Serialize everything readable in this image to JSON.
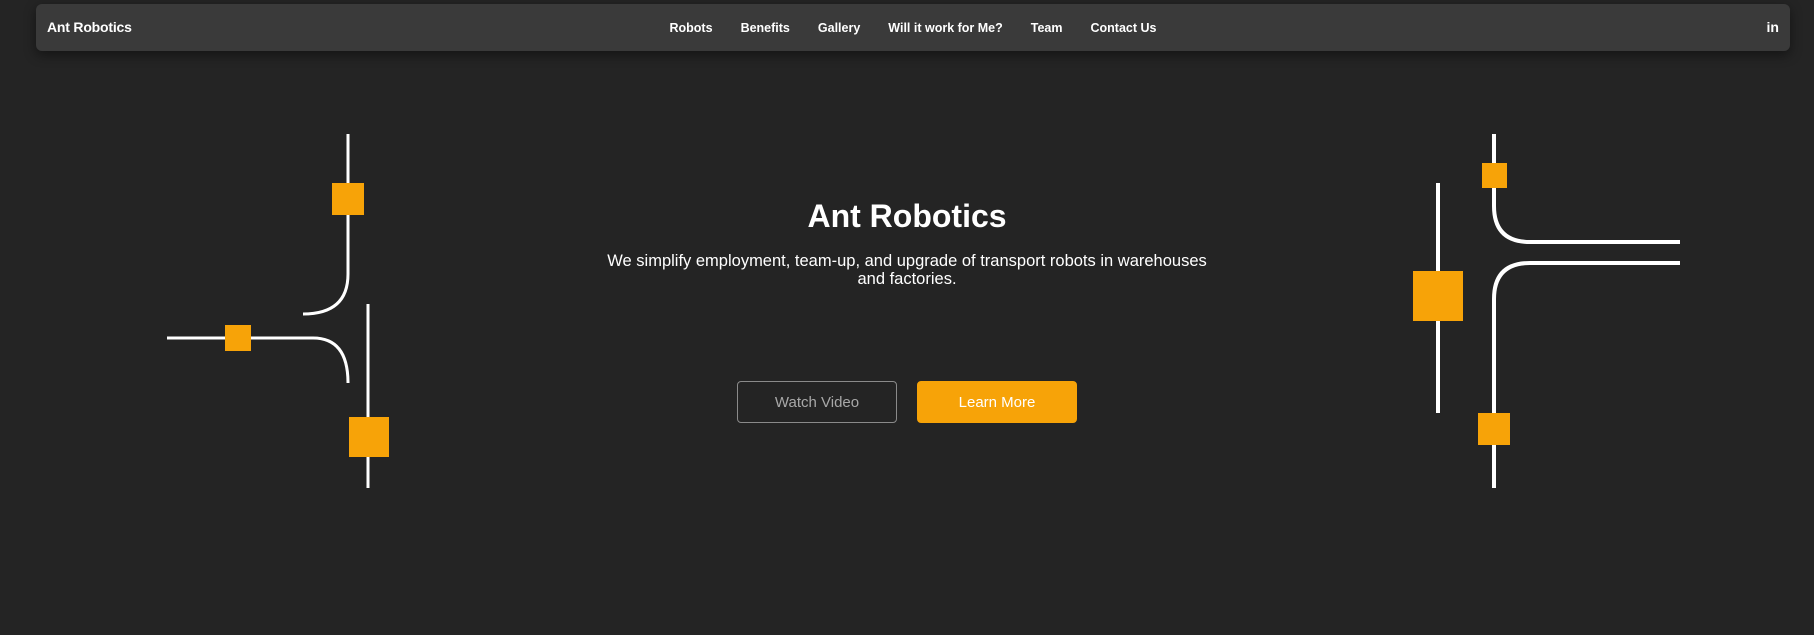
{
  "nav": {
    "brand": "Ant Robotics",
    "links": [
      {
        "label": "Robots"
      },
      {
        "label": "Benefits"
      },
      {
        "label": "Gallery"
      },
      {
        "label": "Will it work for Me?"
      },
      {
        "label": "Team"
      },
      {
        "label": "Contact Us"
      }
    ],
    "social": "in"
  },
  "hero": {
    "title": "Ant Robotics",
    "subtitle": "We simplify employment, team-up, and upgrade of transport robots in warehouses and factories.",
    "watch_video_label": "Watch Video",
    "learn_more_label": "Learn More"
  },
  "colors": {
    "background": "#242424",
    "navbar": "#3a3a3a",
    "accent": "#f7a308",
    "track": "#ffffff"
  }
}
